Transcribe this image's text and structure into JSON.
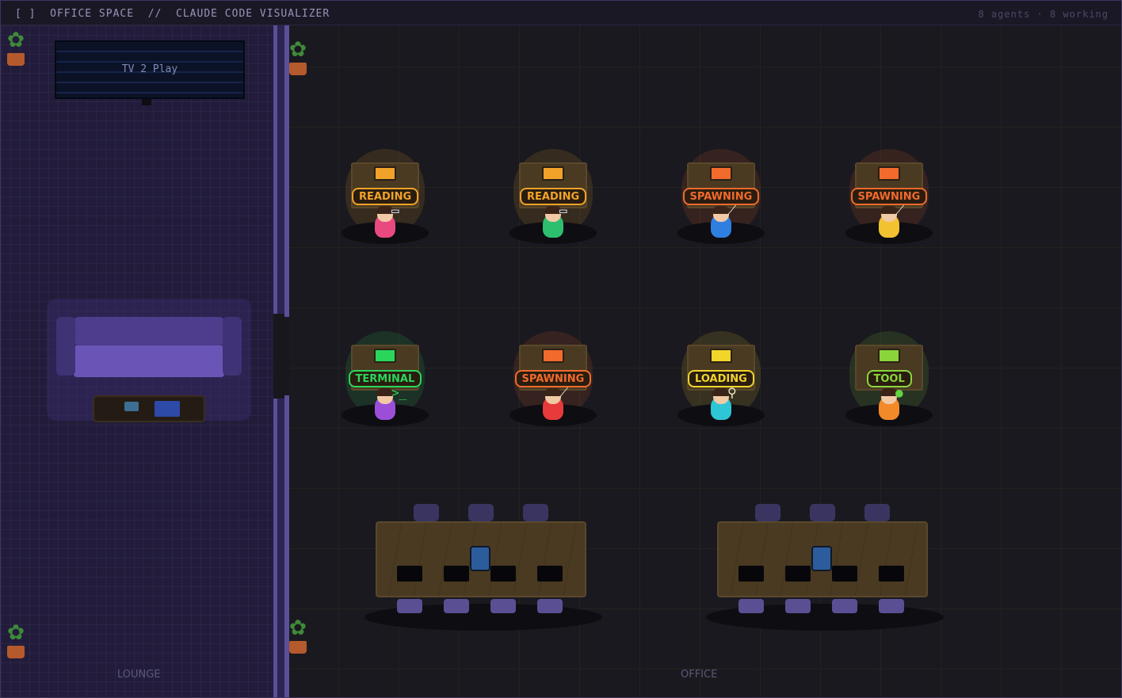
{
  "header": {
    "title": "[ ]  OFFICE SPACE  //  CLAUDE CODE VISUALIZER",
    "agents_count": "8 agents",
    "separator": "·",
    "working_count": "8 working"
  },
  "lounge": {
    "label": "LOUNGE",
    "tv": {
      "label": "TV 2 Play"
    }
  },
  "office": {
    "label": "OFFICE"
  },
  "agents": [
    {
      "status": "READING",
      "color": "#f0a328",
      "shirt": "#e84a7f",
      "tool_icon": "document-icon"
    },
    {
      "status": "READING",
      "color": "#f0a328",
      "shirt": "#2ebf6e",
      "tool_icon": "document-icon"
    },
    {
      "status": "SPAWNING",
      "color": "#f26a2c",
      "shirt": "#2f7fe0",
      "tool_icon": "wand-icon"
    },
    {
      "status": "SPAWNING",
      "color": "#f26a2c",
      "shirt": "#f2c230",
      "tool_icon": "wand-icon"
    },
    {
      "status": "TERMINAL",
      "color": "#2ad65a",
      "shirt": "#9b4fd9",
      "tool_icon": "terminal-icon"
    },
    {
      "status": "SPAWNING",
      "color": "#f26a2c",
      "shirt": "#e83a3a",
      "tool_icon": "wand-icon"
    },
    {
      "status": "LOADING",
      "color": "#f2d52a",
      "shirt": "#2ec6d6",
      "tool_icon": "magnifier-icon"
    },
    {
      "status": "TOOL",
      "color": "#8ad63a",
      "shirt": "#f28a2a",
      "tool_icon": "wrench-icon"
    }
  ],
  "colors": {
    "background": "#18171d",
    "lounge_floor": "#221c3a",
    "wall": "#5a4f98",
    "desk_wood": "#4a3a22"
  }
}
